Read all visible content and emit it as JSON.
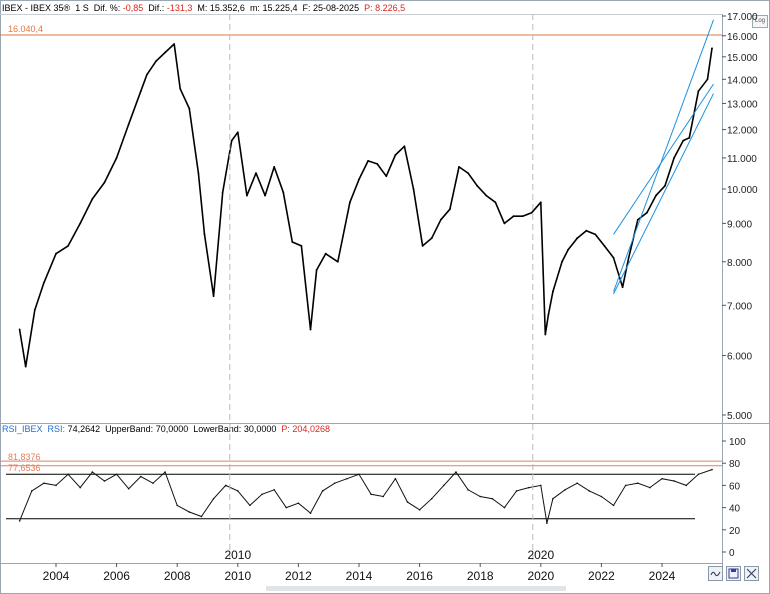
{
  "header": {
    "symbol": "IBEX - IBEX 35®",
    "timeframe": "1 S",
    "dif_pct_label": "Dif. %:",
    "dif_pct_value": "-0,85",
    "dif_label": "Dif.:",
    "dif_value": "-131,3",
    "max_label": "M:",
    "max_value": "15.352,6",
    "min_label": "m:",
    "min_value": "15.225,4",
    "date_label": "F:",
    "date_value": "25-08-2025",
    "p_label": "P:",
    "p_value": "8.226,5"
  },
  "rsi_header": {
    "name": "RSI_IBEX",
    "rsi_label": "RSI:",
    "rsi_value": "74,2642",
    "upper_label": "UpperBand:",
    "upper_value": "70,0000",
    "lower_label": "LowerBand:",
    "lower_value": "30,0000",
    "p_label": "P:",
    "p_value": "204,0268"
  },
  "log_button": "Log",
  "colors": {
    "price": "#000000",
    "channel": "#1e90e0",
    "level": "#e07840",
    "rsi_band": "#000000",
    "rsi_red_line": "#e08060",
    "grid_dash": "#bbbbbb"
  },
  "chart_data": [
    {
      "type": "line",
      "name": "IBEX 35 weekly price",
      "scale": "log",
      "ylim": [
        5000,
        17000
      ],
      "y_ticks": [
        "5.000",
        "6.000",
        "7.000",
        "8.000",
        "9.000",
        "10.000",
        "11.000",
        "12.000",
        "13.000",
        "14.000",
        "15.000",
        "16.000",
        "17.000"
      ],
      "y_tick_values": [
        5000,
        6000,
        7000,
        8000,
        9000,
        10000,
        11000,
        12000,
        13000,
        14000,
        15000,
        16000,
        17000
      ],
      "x_ticks": [
        "2004",
        "2006",
        "2008",
        "2010",
        "2012",
        "2014",
        "2016",
        "2018",
        "2020",
        "2022",
        "2024"
      ],
      "era_labels": [
        "2010",
        "2020"
      ],
      "level_line": {
        "value": 16040.4,
        "label": "16.040,4"
      },
      "x": [
        2002.8,
        2003.0,
        2003.3,
        2003.6,
        2004.0,
        2004.4,
        2004.8,
        2005.2,
        2005.6,
        2006.0,
        2006.4,
        2006.8,
        2007.0,
        2007.3,
        2007.6,
        2007.9,
        2008.1,
        2008.4,
        2008.7,
        2008.9,
        2009.2,
        2009.5,
        2009.8,
        2010.0,
        2010.3,
        2010.6,
        2010.9,
        2011.2,
        2011.5,
        2011.8,
        2012.1,
        2012.4,
        2012.6,
        2012.9,
        2013.3,
        2013.7,
        2014.0,
        2014.3,
        2014.6,
        2014.9,
        2015.2,
        2015.5,
        2015.8,
        2016.1,
        2016.4,
        2016.7,
        2017.0,
        2017.3,
        2017.6,
        2017.9,
        2018.2,
        2018.5,
        2018.8,
        2019.1,
        2019.4,
        2019.7,
        2020.0,
        2020.15,
        2020.25,
        2020.4,
        2020.7,
        2020.9,
        2021.2,
        2021.5,
        2021.8,
        2022.1,
        2022.4,
        2022.7,
        2022.9,
        2023.2,
        2023.5,
        2023.8,
        2024.1,
        2024.4,
        2024.7,
        2024.9,
        2025.2,
        2025.5,
        2025.65
      ],
      "y": [
        6500,
        5800,
        6900,
        7500,
        8200,
        8400,
        9000,
        9700,
        10200,
        11000,
        12200,
        13500,
        14200,
        14800,
        15200,
        15600,
        13600,
        12800,
        10500,
        8700,
        7200,
        9900,
        11600,
        11900,
        9800,
        10500,
        9800,
        10700,
        9900,
        8500,
        8400,
        6500,
        7800,
        8200,
        8000,
        9600,
        10300,
        10900,
        10800,
        10400,
        11100,
        11400,
        10000,
        8400,
        8600,
        9100,
        9400,
        10700,
        10500,
        10100,
        9800,
        9600,
        9000,
        9200,
        9200,
        9300,
        9600,
        6400,
        6800,
        7300,
        8000,
        8300,
        8600,
        8800,
        8700,
        8400,
        8100,
        7400,
        8100,
        9100,
        9300,
        9800,
        10100,
        11000,
        11600,
        11700,
        13500,
        14000,
        15400
      ],
      "channel_lines": [
        {
          "x": [
            2022.4,
            2025.7
          ],
          "y": [
            7300,
            16800
          ]
        },
        {
          "x": [
            2022.4,
            2025.7
          ],
          "y": [
            7250,
            13400
          ]
        },
        {
          "x": [
            2022.4,
            2025.7
          ],
          "y": [
            8700,
            13800
          ]
        }
      ]
    },
    {
      "type": "line",
      "name": "RSI",
      "ylim": [
        0,
        100
      ],
      "y_ticks": [
        "0",
        "20",
        "40",
        "60",
        "80",
        "100"
      ],
      "y_tick_values": [
        0,
        20,
        40,
        60,
        80,
        100
      ],
      "level_labels": [
        "81,8376",
        "77,6536"
      ],
      "level_values": [
        81.8376,
        77.6536
      ],
      "bands": [
        70,
        30
      ],
      "x": [
        2002.8,
        2003.2,
        2003.6,
        2004.0,
        2004.4,
        2004.8,
        2005.2,
        2005.6,
        2006.0,
        2006.4,
        2006.8,
        2007.2,
        2007.6,
        2008.0,
        2008.4,
        2008.8,
        2009.2,
        2009.6,
        2010.0,
        2010.4,
        2010.8,
        2011.2,
        2011.6,
        2012.0,
        2012.4,
        2012.8,
        2013.2,
        2013.6,
        2014.0,
        2014.4,
        2014.8,
        2015.2,
        2015.6,
        2016.0,
        2016.4,
        2016.8,
        2017.2,
        2017.6,
        2018.0,
        2018.4,
        2018.8,
        2019.2,
        2019.6,
        2020.0,
        2020.2,
        2020.4,
        2020.8,
        2021.2,
        2021.6,
        2022.0,
        2022.4,
        2022.8,
        2023.2,
        2023.6,
        2024.0,
        2024.4,
        2024.8,
        2025.2,
        2025.65
      ],
      "y": [
        28,
        55,
        62,
        60,
        70,
        58,
        72,
        64,
        70,
        57,
        68,
        62,
        72,
        42,
        36,
        32,
        48,
        60,
        55,
        42,
        52,
        56,
        40,
        44,
        35,
        55,
        62,
        66,
        70,
        52,
        50,
        66,
        45,
        38,
        48,
        60,
        72,
        56,
        50,
        48,
        40,
        55,
        58,
        60,
        26,
        48,
        56,
        62,
        55,
        50,
        42,
        60,
        62,
        58,
        66,
        64,
        60,
        70,
        74.26
      ]
    }
  ]
}
